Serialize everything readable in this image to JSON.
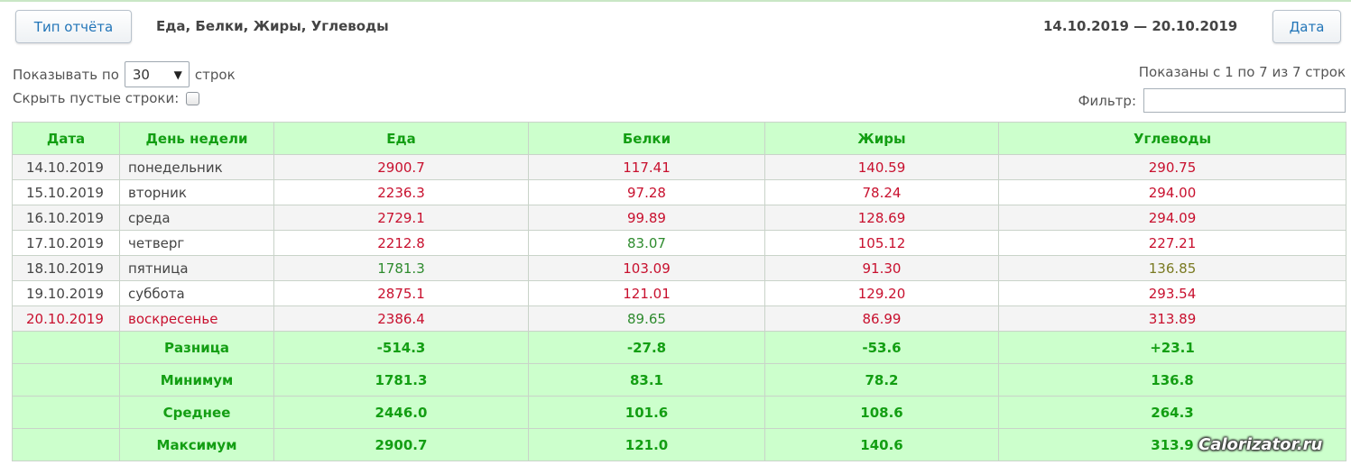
{
  "toolbar": {
    "report_type_label": "Тип отчёта",
    "report_title": "Еда, Белки, Жиры, Углеводы",
    "date_range": "14.10.2019 — 20.10.2019",
    "date_button_label": "Дата"
  },
  "controls": {
    "show_per_label": "Показывать по",
    "page_size": "30",
    "rows_word": "строк",
    "hide_empty_label": "Скрыть пустые строки:",
    "shown_text": "Показаны с 1 по 7 из 7 строк",
    "filter_label": "Фильтр:",
    "filter_value": ""
  },
  "table": {
    "headers": [
      "Дата",
      "День недели",
      "Еда",
      "Белки",
      "Жиры",
      "Углеводы"
    ],
    "rows": [
      {
        "date": "14.10.2019",
        "day": "понедельник",
        "food": "2900.7",
        "protein": "117.41",
        "fat": "140.59",
        "carbs": "290.75"
      },
      {
        "date": "15.10.2019",
        "day": "вторник",
        "food": "2236.3",
        "protein": "97.28",
        "fat": "78.24",
        "carbs": "294.00"
      },
      {
        "date": "16.10.2019",
        "day": "среда",
        "food": "2729.1",
        "protein": "99.89",
        "fat": "128.69",
        "carbs": "294.09"
      },
      {
        "date": "17.10.2019",
        "day": "четверг",
        "food": "2212.8",
        "protein": "83.07",
        "fat": "105.12",
        "carbs": "227.21"
      },
      {
        "date": "18.10.2019",
        "day": "пятница",
        "food": "1781.3",
        "protein": "103.09",
        "fat": "91.30",
        "carbs": "136.85"
      },
      {
        "date": "19.10.2019",
        "day": "суббота",
        "food": "2875.1",
        "protein": "121.01",
        "fat": "129.20",
        "carbs": "293.54"
      },
      {
        "date": "20.10.2019",
        "day": "воскресенье",
        "food": "2386.4",
        "protein": "89.65",
        "fat": "86.99",
        "carbs": "313.89"
      }
    ],
    "summary": [
      {
        "label": "Разница",
        "food": "-514.3",
        "protein": "-27.8",
        "fat": "-53.6",
        "carbs": "+23.1"
      },
      {
        "label": "Минимум",
        "food": "1781.3",
        "protein": "83.1",
        "fat": "78.2",
        "carbs": "136.8"
      },
      {
        "label": "Среднее",
        "food": "2446.0",
        "protein": "101.6",
        "fat": "108.6",
        "carbs": "264.3"
      },
      {
        "label": "Максимум",
        "food": "2900.7",
        "protein": "121.0",
        "fat": "140.6",
        "carbs": "313.9"
      }
    ]
  },
  "colors": {
    "header_bg": "#ccffcc",
    "header_text": "#139e13",
    "over_value": "#c8102e",
    "under_value": "#2e8b2e",
    "low_value": "#7a7a22"
  },
  "watermark": "Calorizator.ru"
}
